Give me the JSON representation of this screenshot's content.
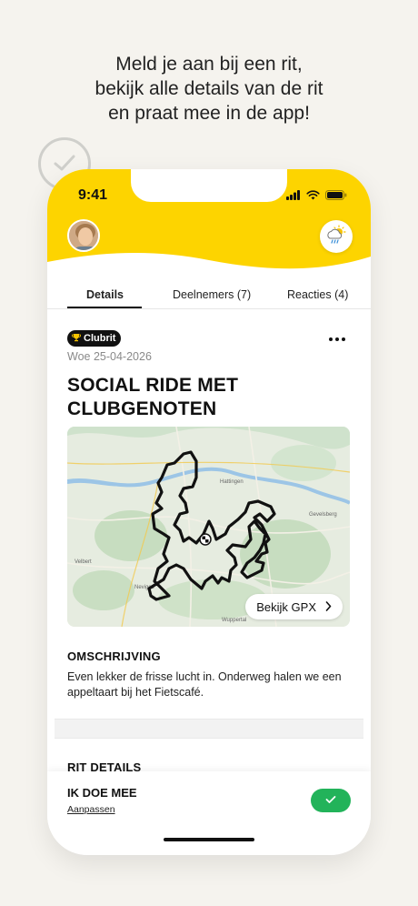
{
  "promo": {
    "line1": "Meld je aan bij een rit,",
    "line2": "bekijk alle details van de rit",
    "line3": "en praat mee in de app!"
  },
  "status_bar": {
    "time": "9:41",
    "icons": [
      "signal-icon",
      "wifi-icon",
      "battery-icon"
    ]
  },
  "header": {
    "avatar": "avatar",
    "weather_icon": "partly-cloudy-rain-icon",
    "accent_color": "#fdd400"
  },
  "tabs": [
    {
      "label": "Details",
      "active": true
    },
    {
      "label": "Deelnemers (7)",
      "active": false
    },
    {
      "label": "Reacties (4)",
      "active": false
    }
  ],
  "ride": {
    "badge": "Clubrit",
    "badge_icon": "trophy-icon",
    "date": "Woe 25-04-2026",
    "title": "SOCIAL RIDE MET CLUBGENOTEN",
    "map": {
      "labels": [
        "Hattingen",
        "Velbert",
        "Neviges",
        "Wuppertal",
        "Gevelsberg"
      ],
      "gpx_button": "Bekijk GPX"
    },
    "description_title": "OMSCHRIJVING",
    "description": "Even lekker de frisse lucht in. Onderweg halen we een appeltaart bij het Fietscafé.",
    "details_title": "RIT DETAILS"
  },
  "bottom_bar": {
    "title": "IK DOE MEE",
    "link": "Aanpassen",
    "toggle_on": true,
    "toggle_color": "#22b35a"
  }
}
